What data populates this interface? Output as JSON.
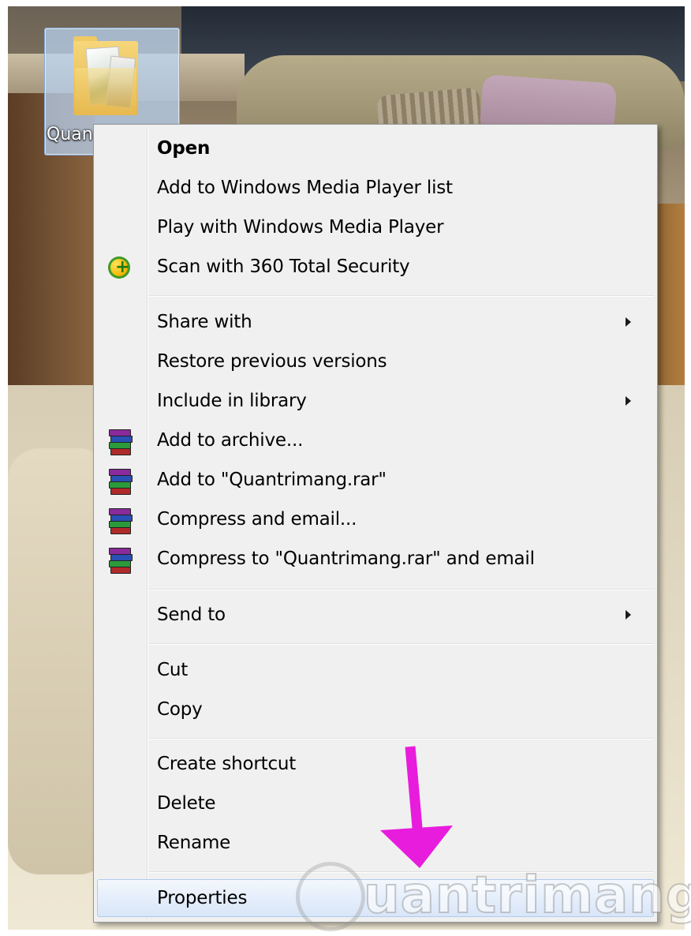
{
  "desktop": {
    "folder_label": "Quan"
  },
  "context_menu": {
    "items": [
      {
        "label": "Open",
        "bold": true,
        "icon": null,
        "submenu": false
      },
      {
        "label": "Add to Windows Media Player list",
        "icon": null,
        "submenu": false
      },
      {
        "label": "Play with Windows Media Player",
        "icon": null,
        "submenu": false
      },
      {
        "label": "Scan with 360 Total Security",
        "icon": "360-total-security-icon",
        "submenu": false
      },
      {
        "label": "Share with",
        "icon": null,
        "submenu": true
      },
      {
        "label": "Restore previous versions",
        "icon": null,
        "submenu": false
      },
      {
        "label": "Include in library",
        "icon": null,
        "submenu": true
      },
      {
        "label": "Add to archive...",
        "icon": "winrar-icon",
        "submenu": false
      },
      {
        "label": "Add to \"Quantrimang.rar\"",
        "icon": "winrar-icon",
        "submenu": false
      },
      {
        "label": "Compress and email...",
        "icon": "winrar-icon",
        "submenu": false
      },
      {
        "label": "Compress to \"Quantrimang.rar\" and email",
        "icon": "winrar-icon",
        "submenu": false
      },
      {
        "label": "Send to",
        "icon": null,
        "submenu": true
      },
      {
        "label": "Cut",
        "icon": null,
        "submenu": false
      },
      {
        "label": "Copy",
        "icon": null,
        "submenu": false
      },
      {
        "label": "Create shortcut",
        "icon": null,
        "submenu": false
      },
      {
        "label": "Delete",
        "icon": null,
        "submenu": false
      },
      {
        "label": "Rename",
        "icon": null,
        "submenu": false
      },
      {
        "label": "Properties",
        "icon": null,
        "submenu": false,
        "highlighted": true
      }
    ]
  },
  "annotation": {
    "arrow_color": "#e81cdc"
  },
  "watermark": {
    "text": "uantrimang"
  },
  "colors": {
    "menu_background": "#f0f0f0",
    "menu_border": "#979797",
    "hover_border": "#aeccf1"
  }
}
